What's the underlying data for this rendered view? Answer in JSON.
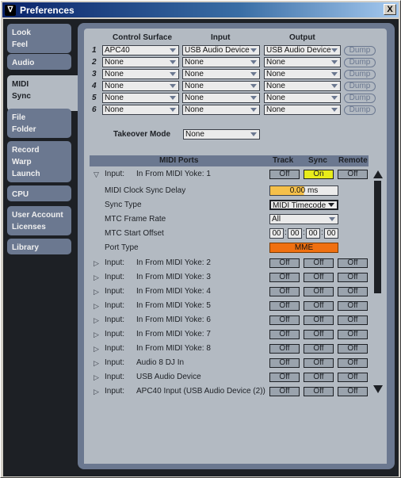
{
  "window": {
    "title": "Preferences",
    "close_label": "X"
  },
  "sidebar": {
    "tabs": [
      {
        "label": "Look\nFeel",
        "lines": [
          "Look",
          "Feel"
        ]
      },
      {
        "label": "Audio",
        "lines": [
          "Audio"
        ]
      },
      {
        "label": "MIDI\nSync",
        "lines": [
          "MIDI",
          "Sync"
        ],
        "active": true
      },
      {
        "label": "File\nFolder",
        "lines": [
          "File",
          "Folder"
        ]
      },
      {
        "label": "Record\nWarp\nLaunch",
        "lines": [
          "Record",
          "Warp",
          "Launch"
        ]
      },
      {
        "label": "CPU",
        "lines": [
          "CPU"
        ]
      },
      {
        "label": "User Account\nLicenses",
        "lines": [
          "User Account",
          "Licenses"
        ]
      },
      {
        "label": "Library",
        "lines": [
          "Library"
        ]
      }
    ]
  },
  "control_surfaces": {
    "headers": {
      "surface": "Control Surface",
      "input": "Input",
      "output": "Output"
    },
    "dump_label": "Dump",
    "rows": [
      {
        "num": "1",
        "surface": "APC40",
        "input": "USB Audio Device",
        "output": "USB Audio Device"
      },
      {
        "num": "2",
        "surface": "None",
        "input": "None",
        "output": "None"
      },
      {
        "num": "3",
        "surface": "None",
        "input": "None",
        "output": "None"
      },
      {
        "num": "4",
        "surface": "None",
        "input": "None",
        "output": "None"
      },
      {
        "num": "5",
        "surface": "None",
        "input": "None",
        "output": "None"
      },
      {
        "num": "6",
        "surface": "None",
        "input": "None",
        "output": "None"
      }
    ]
  },
  "takeover": {
    "label": "Takeover Mode",
    "value": "None"
  },
  "midi_ports": {
    "headers": {
      "ports": "MIDI Ports",
      "track": "Track",
      "sync": "Sync",
      "remote": "Remote"
    },
    "expanded": {
      "clock_delay_label": "MIDI Clock Sync Delay",
      "clock_delay_value": "0.00 ms",
      "sync_type_label": "Sync Type",
      "sync_type_value": "MIDI Timecode",
      "frame_rate_label": "MTC Frame Rate",
      "frame_rate_value": "All",
      "start_offset_label": "MTC Start Offset",
      "start_offset": [
        "00",
        "00",
        "00",
        "00"
      ],
      "port_type_label": "Port Type",
      "port_type_value": "MME"
    },
    "rows": [
      {
        "dir": "Input:",
        "name": "In From MIDI Yoke:  1",
        "track": "Off",
        "sync": "On",
        "remote": "Off",
        "expanded": true
      },
      {
        "dir": "Input:",
        "name": "In From MIDI Yoke:  2",
        "track": "Off",
        "sync": "Off",
        "remote": "Off"
      },
      {
        "dir": "Input:",
        "name": "In From MIDI Yoke:  3",
        "track": "Off",
        "sync": "Off",
        "remote": "Off"
      },
      {
        "dir": "Input:",
        "name": "In From MIDI Yoke:  4",
        "track": "Off",
        "sync": "Off",
        "remote": "Off"
      },
      {
        "dir": "Input:",
        "name": "In From MIDI Yoke:  5",
        "track": "Off",
        "sync": "Off",
        "remote": "Off"
      },
      {
        "dir": "Input:",
        "name": "In From MIDI Yoke:  6",
        "track": "Off",
        "sync": "Off",
        "remote": "Off"
      },
      {
        "dir": "Input:",
        "name": "In From MIDI Yoke:  7",
        "track": "Off",
        "sync": "Off",
        "remote": "Off"
      },
      {
        "dir": "Input:",
        "name": "In From MIDI Yoke:  8",
        "track": "Off",
        "sync": "Off",
        "remote": "Off"
      },
      {
        "dir": "Input:",
        "name": "Audio 8 DJ In",
        "track": "Off",
        "sync": "Off",
        "remote": "Off"
      },
      {
        "dir": "Input:",
        "name": "USB Audio Device",
        "track": "Off",
        "sync": "Off",
        "remote": "Off"
      },
      {
        "dir": "Input:",
        "name": "APC40 Input (USB Audio Device (2))",
        "track": "Off",
        "sync": "Off",
        "remote": "Off"
      }
    ]
  },
  "colors": {
    "sync_on": "#e8ec1a",
    "port_type": "#f07010",
    "delay_fill": "#f5c04a"
  }
}
